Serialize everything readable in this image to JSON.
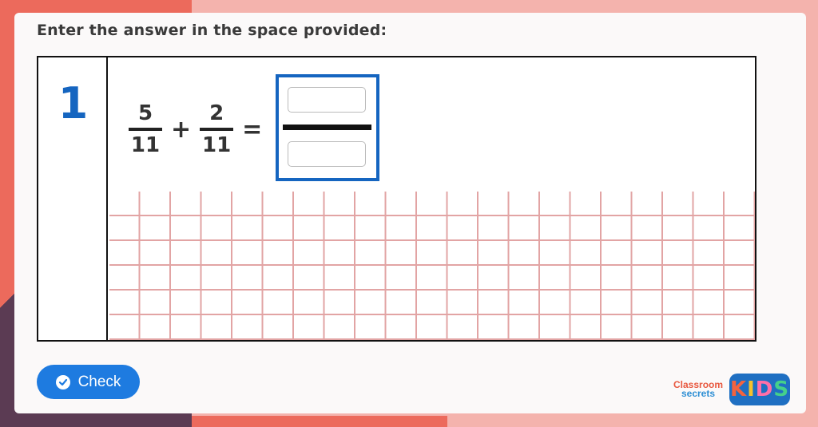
{
  "instruction": "Enter the answer in the space provided:",
  "question": {
    "number": "1",
    "fraction1": {
      "numerator": "5",
      "denominator": "11"
    },
    "operator": "+",
    "fraction2": {
      "numerator": "2",
      "denominator": "11"
    },
    "equals": "=",
    "answer": {
      "numerator_value": "",
      "denominator_value": ""
    }
  },
  "check_button": {
    "label": "Check",
    "icon": "check-circle-icon"
  },
  "logo": {
    "line1": "Classroom",
    "line2": "secrets",
    "kids": [
      "K",
      "I",
      "D",
      "S"
    ]
  },
  "colors": {
    "accent_blue": "#1565c0",
    "button_blue": "#1e7be0",
    "grid_pink": "#e2a4a4",
    "background_pink": "#f4b3ad"
  }
}
